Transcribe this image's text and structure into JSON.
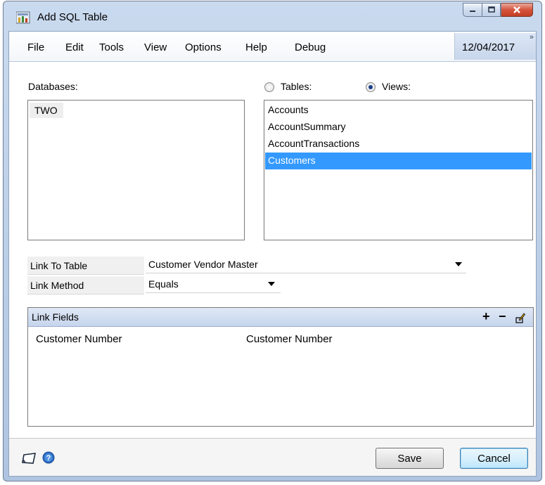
{
  "window": {
    "title": "Add SQL Table"
  },
  "menu": {
    "items": [
      "File",
      "Edit",
      "Tools",
      "View",
      "Options",
      "Help",
      "Debug"
    ],
    "date": "12/04/2017"
  },
  "databases": {
    "label": "Databases:",
    "items": [
      "TWO"
    ]
  },
  "object_type": {
    "tables_label": "Tables:",
    "views_label": "Views:",
    "selected": "Views"
  },
  "views": {
    "items": [
      "Accounts",
      "AccountSummary",
      "AccountTransactions",
      "Customers"
    ],
    "selected_index": 3
  },
  "link_to_table": {
    "label": "Link To Table",
    "value": "Customer Vendor Master"
  },
  "link_method": {
    "label": "Link Method",
    "value": "Equals"
  },
  "link_fields": {
    "header": "Link Fields",
    "rows": [
      {
        "left": "Customer Number",
        "right": "Customer Number"
      }
    ]
  },
  "buttons": {
    "save": "Save",
    "cancel": "Cancel"
  },
  "colors": {
    "selection": "#3399ff",
    "header_blue": "#c6d5ec"
  }
}
